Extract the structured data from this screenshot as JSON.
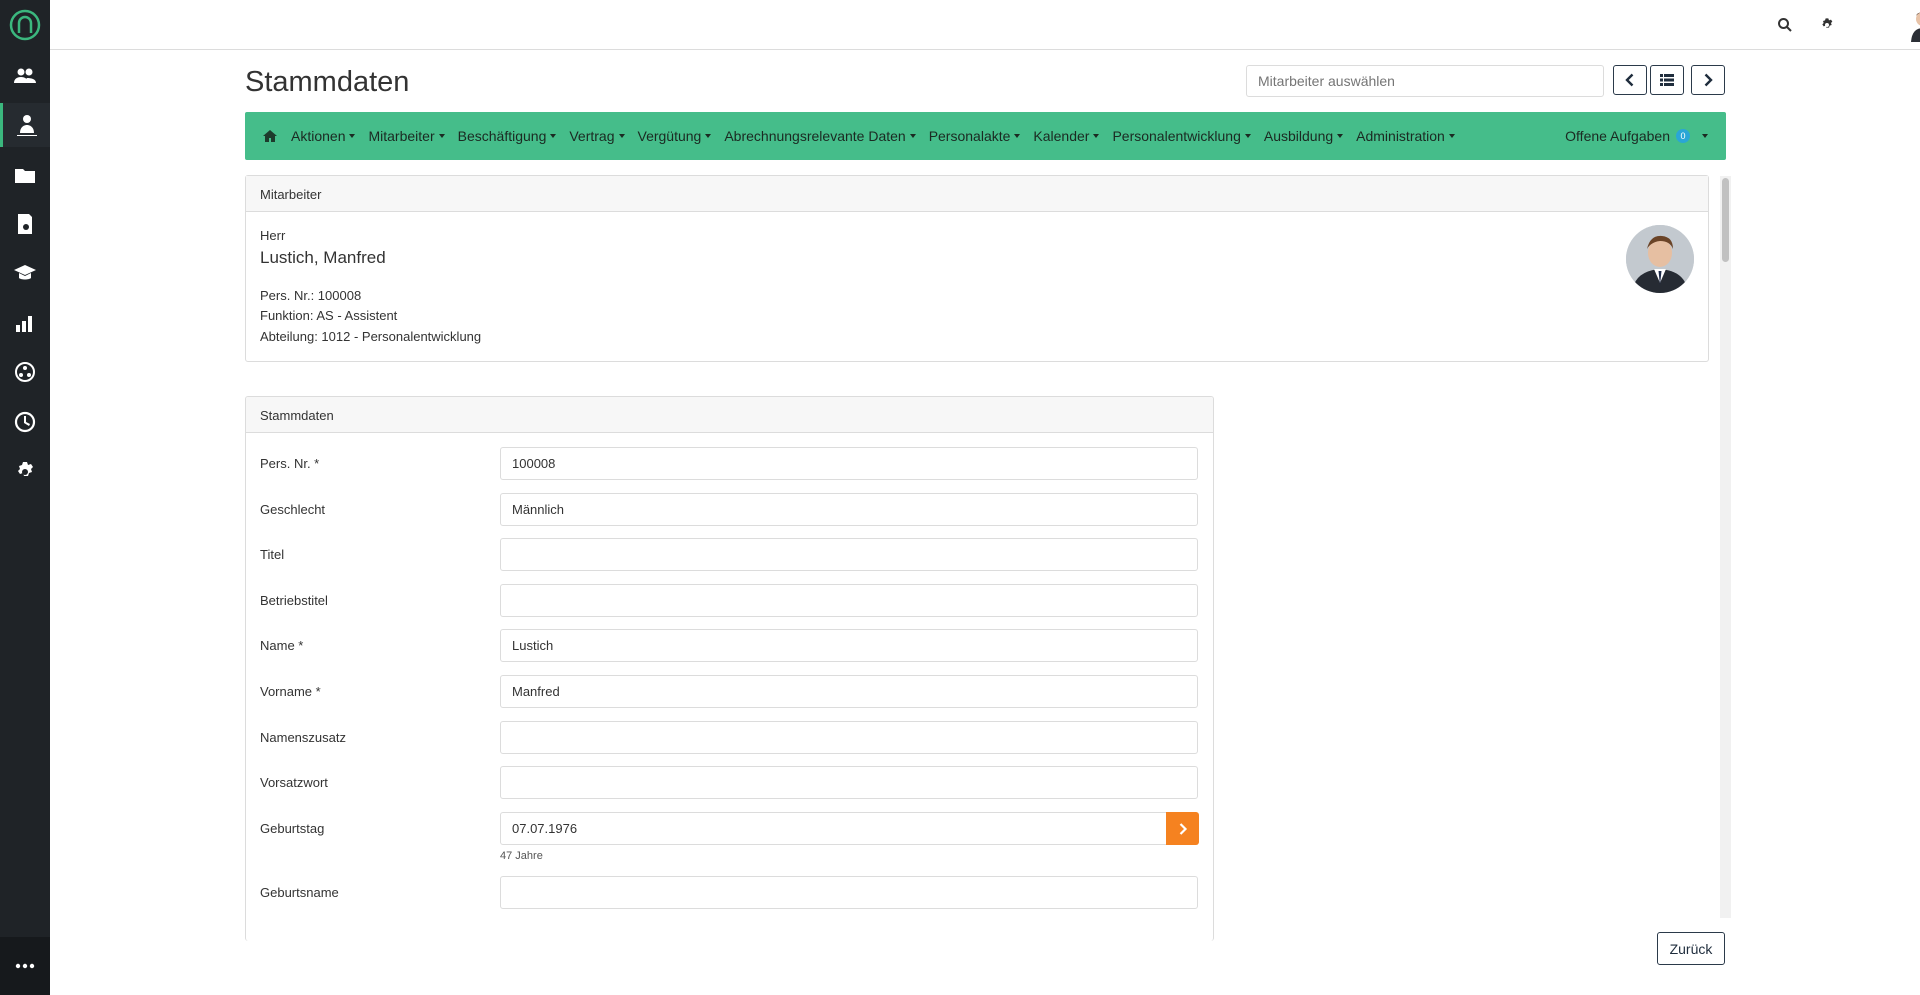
{
  "sidebar": {
    "logo_icon": "app-logo-icon",
    "items": [
      {
        "icon": "users-icon"
      },
      {
        "icon": "user-tree-icon",
        "active": true
      },
      {
        "icon": "folder-icon"
      },
      {
        "icon": "document-search-icon"
      },
      {
        "icon": "graduation-cap-icon"
      },
      {
        "icon": "bar-chart-icon"
      },
      {
        "icon": "network-icon"
      },
      {
        "icon": "clock-icon"
      },
      {
        "icon": "gear-icon"
      }
    ],
    "more_icon": "more-dots-icon"
  },
  "topbar": {
    "search_icon": "search-icon",
    "settings_icon": "gear-icon",
    "avatar_icon": "user-avatar"
  },
  "page": {
    "title": "Stammdaten"
  },
  "employee_select": {
    "placeholder": "Mitarbeiter auswählen"
  },
  "menu": {
    "items": [
      "Aktionen",
      "Mitarbeiter",
      "Beschäftigung",
      "Vertrag",
      "Vergütung",
      "Abrechnungsrelevante Daten",
      "Personalakte",
      "Kalender",
      "Personalentwicklung",
      "Ausbildung",
      "Administration"
    ],
    "right_label": "Offene Aufgaben",
    "badge_count": "0",
    "accent_color": "#45bd8a"
  },
  "employee_card": {
    "header": "Mitarbeiter",
    "salutation": "Herr",
    "name": "Lustich, Manfred",
    "pers_nr": "Pers. Nr.: 100008",
    "funktion": "Funktion: AS - Assistent",
    "abteilung": "Abteilung: 1012 - Personalentwicklung"
  },
  "form": {
    "header": "Stammdaten",
    "fields": [
      {
        "label": "Pers. Nr. *",
        "value": "100008"
      },
      {
        "label": "Geschlecht",
        "value": "Männlich"
      },
      {
        "label": "Titel",
        "value": ""
      },
      {
        "label": "Betriebstitel",
        "value": ""
      },
      {
        "label": "Name *",
        "value": "Lustich"
      },
      {
        "label": "Vorname *",
        "value": "Manfred"
      },
      {
        "label": "Namenszusatz",
        "value": ""
      },
      {
        "label": "Vorsatzwort",
        "value": ""
      },
      {
        "label": "Geburtstag",
        "value": "07.07.1976"
      },
      {
        "label": "Geburtsname",
        "value": ""
      }
    ],
    "geburtstag_help": "47 Jahre",
    "date_button_color": "#f58220"
  },
  "footer": {
    "back_label": "Zurück"
  }
}
